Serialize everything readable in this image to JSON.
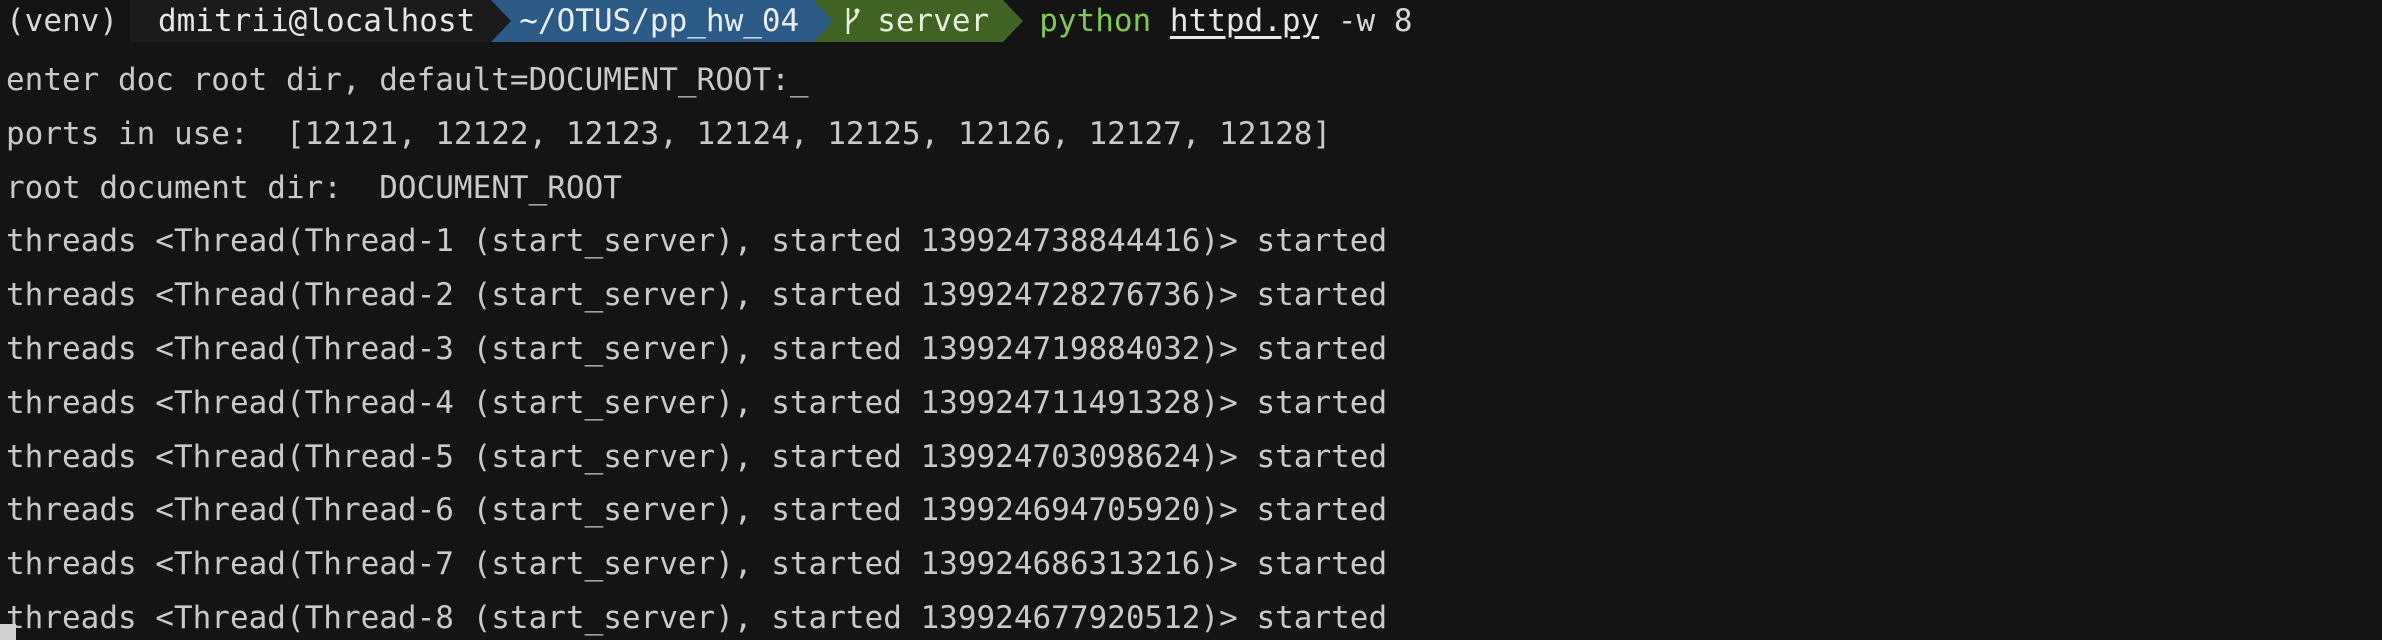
{
  "prompt": {
    "venv": "(venv)",
    "user_host": "dmitrii@localhost",
    "path": "~/OTUS/pp_hw_04",
    "branch": "server",
    "command": {
      "program": "python",
      "file": "httpd.py",
      "args": " -w 8"
    }
  },
  "output": [
    "enter doc root dir, default=DOCUMENT_ROOT:_",
    "ports in use:  [12121, 12122, 12123, 12124, 12125, 12126, 12127, 12128]",
    "root document dir:  DOCUMENT_ROOT",
    "threads <Thread(Thread-1 (start_server), started 139924738844416)> started",
    "threads <Thread(Thread-2 (start_server), started 139924728276736)> started",
    "threads <Thread(Thread-3 (start_server), started 139924719884032)> started",
    "threads <Thread(Thread-4 (start_server), started 139924711491328)> started",
    "threads <Thread(Thread-5 (start_server), started 139924703098624)> started",
    "threads <Thread(Thread-6 (start_server), started 139924694705920)> started",
    "threads <Thread(Thread-7 (start_server), started 139924686313216)> started",
    "threads <Thread(Thread-8 (start_server), started 139924677920512)> started"
  ],
  "colors": {
    "background": "#141414",
    "path_segment": "#2b5b86",
    "git_segment": "#3f6424",
    "python_command": "#7fc94e"
  },
  "icons": {
    "branch": "git-branch-icon"
  }
}
